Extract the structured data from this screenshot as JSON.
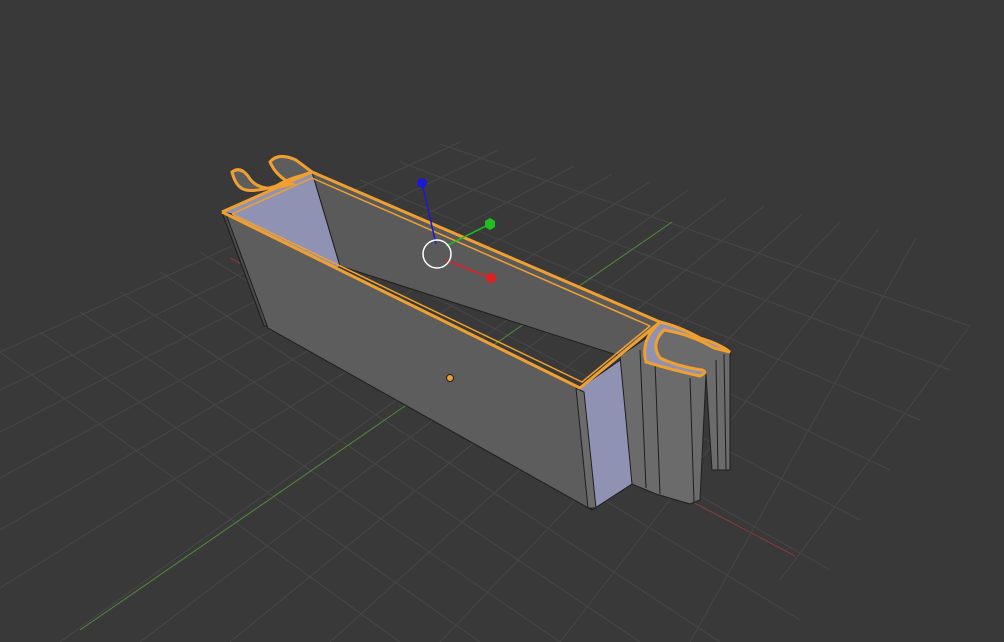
{
  "viewport": {
    "background_color": "#393939",
    "grid_color": "#474747",
    "x_axis_color": "#8a3a3a",
    "y_axis_color": "#4f8a3a"
  },
  "object": {
    "face_color": "#5d5d5d",
    "side_face_color": "#6b6b6b",
    "inner_face_color": "#8f92b3",
    "edge_color": "#1e1e1e",
    "selection_outline_color": "#f0a030",
    "origin_icon": "object-origin-dot"
  },
  "gizmo": {
    "x_axis_color": "#e02020",
    "y_axis_color": "#20c020",
    "z_axis_color": "#1a1ad0",
    "center_ring_color": "#ffffff",
    "icons": [
      "x-axis-handle",
      "y-axis-handle",
      "z-axis-handle",
      "center-ring"
    ]
  }
}
